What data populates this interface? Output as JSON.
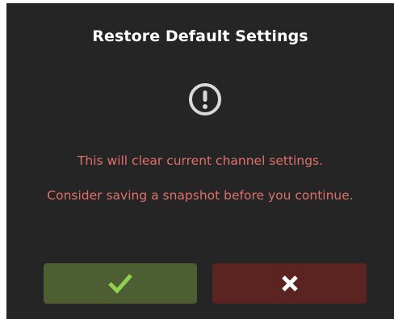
{
  "dialog": {
    "title": "Restore Default Settings",
    "icon": "exclamation-circle-icon",
    "message_line1": "This will clear current channel settings.",
    "message_line2": "Consider saving a snapshot before you continue."
  },
  "buttons": {
    "confirm": {
      "icon": "checkmark-icon",
      "color": "#4d5e33",
      "icon_color": "#8fd14f"
    },
    "cancel": {
      "icon": "close-icon",
      "color": "#5c2421",
      "icon_color": "#ffffff"
    }
  },
  "colors": {
    "background": "#252525",
    "title": "#ffffff",
    "message": "#e0706a",
    "icon": "#d9d9d9"
  }
}
